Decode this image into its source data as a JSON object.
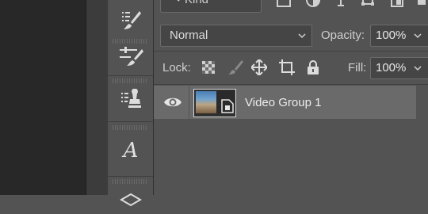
{
  "toolbar": {
    "tools": [
      {
        "icon": "brush-history-icon"
      },
      {
        "icon": "adjust-brush-icon"
      },
      {
        "icon": "clone-stamp-icon"
      },
      {
        "icon": "character-icon",
        "glyph": "A"
      },
      {
        "icon": "layers-icon"
      }
    ]
  },
  "layers_panel": {
    "filter": {
      "kind_label": "Kind"
    },
    "blend_mode": "Normal",
    "opacity_label": "Opacity:",
    "opacity_value": "100%",
    "lock_label": "Lock:",
    "fill_label": "Fill:",
    "fill_value": "100%",
    "layers": [
      {
        "name": "Video Group 1",
        "visible": true,
        "selected": true
      }
    ]
  },
  "colors": {
    "panel_bg": "#535353",
    "selected_row": "#6a6a6a",
    "dark_area": "#282828"
  }
}
